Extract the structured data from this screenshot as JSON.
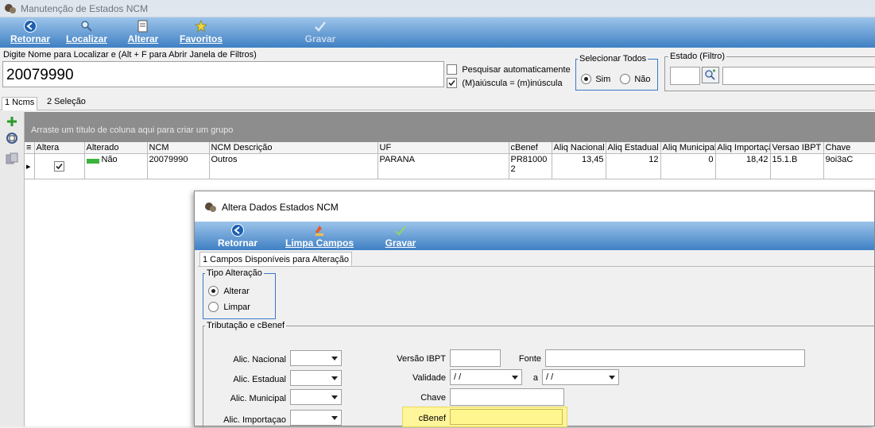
{
  "window": {
    "title": "Manutenção de Estados NCM"
  },
  "toolbar": {
    "retornar": "Retornar",
    "localizar": "Localizar",
    "alterar": "Alterar",
    "favoritos": "Favoritos",
    "gravar": "Gravar"
  },
  "search": {
    "label": "Digite Nome para Localizar e (Alt + F para Abrir Janela de Filtros)",
    "value": "20079990",
    "auto_search_label": "Pesquisar automaticamente",
    "case_label": "(M)aiúscula = (m)inúscula"
  },
  "select_all": {
    "title": "Selecionar Todos",
    "sim": "Sim",
    "nao": "Não"
  },
  "estado_filter": {
    "title": "Estado (Filtro)"
  },
  "tabs": {
    "ncms": "1 Ncms",
    "selecao": "2 Seleção"
  },
  "grid": {
    "group_hint": "Arraste um título de coluna aqui para criar um grupo",
    "headers": [
      "Altera",
      "Alterado",
      "NCM",
      "NCM Descrição",
      "UF",
      "cBenef",
      "Aliq Nacional",
      "Aliq Estadual",
      "Aliq Municipal",
      "Aliq Importação",
      "Versao IBPT",
      "Chave"
    ],
    "row": {
      "alterado": "Não",
      "ncm": "20079990",
      "descricao": "Outros",
      "uf": "PARANA",
      "cbenef_line1": "PR81000",
      "cbenef_line2": "2",
      "aliq_nacional": "13,45",
      "aliq_estadual": "12",
      "aliq_municipal": "0",
      "aliq_importacao": "18,42",
      "versao_ibpt": "15.1.B",
      "chave": "9oi3aC"
    }
  },
  "dialog": {
    "title": "Altera Dados Estados NCM",
    "toolbar": {
      "retornar": "Retornar",
      "limpa": "Limpa Campos",
      "gravar": "Gravar"
    },
    "tab": "1 Campos Disponíveis para Alteração",
    "tipo": {
      "title": "Tipo Alteração",
      "alterar": "Alterar",
      "limpar": "Limpar"
    },
    "trib": {
      "title": "Tributação e cBenef",
      "alic_nacional": "Alic. Nacional",
      "alic_estadual": "Alic. Estadual",
      "alic_municipal": "Alic. Municipal",
      "alic_importacao": "Alic. Importaçao",
      "versao_ibpt": "Versão IBPT",
      "fonte": "Fonte",
      "validade": "Validade",
      "a": "a",
      "date_placeholder": "/ /",
      "chave": "Chave",
      "cbenef": "cBenef"
    }
  },
  "colors": {
    "toolbar_top": "#9cc4ea",
    "toolbar_bottom": "#3f80c4",
    "highlight": "#fff59a",
    "highlight_border": "#e8d85a"
  }
}
